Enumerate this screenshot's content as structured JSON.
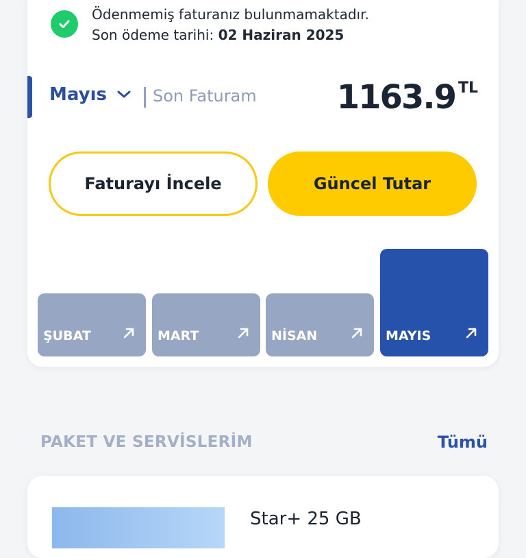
{
  "notice": {
    "line1": "Ödenmemiş faturanız bulunmamaktadır.",
    "due_prefix": "Son ödeme tarihi: ",
    "due_date": "02 Haziran 2025"
  },
  "bill": {
    "month": "Mayıs",
    "subtitle": "Son Faturam",
    "amount": "1163.9",
    "currency": "TL"
  },
  "buttons": {
    "review": "Faturayı İncele",
    "current": "Güncel Tutar"
  },
  "months": [
    {
      "label": "ŞUBAT",
      "selected": false
    },
    {
      "label": "MART",
      "selected": false
    },
    {
      "label": "NİSAN",
      "selected": false
    },
    {
      "label": "MAYIS",
      "selected": true
    }
  ],
  "packages_section": {
    "title": "PAKET VE SERVİSLERİM",
    "see_all": "Tümü"
  },
  "package": {
    "name": "Star+ 25 GB"
  },
  "colors": {
    "accent_blue": "#2b52a9",
    "brand_yellow": "#fecb00",
    "success_green": "#1fcb6b",
    "tile_inactive": "#97a6c3"
  }
}
